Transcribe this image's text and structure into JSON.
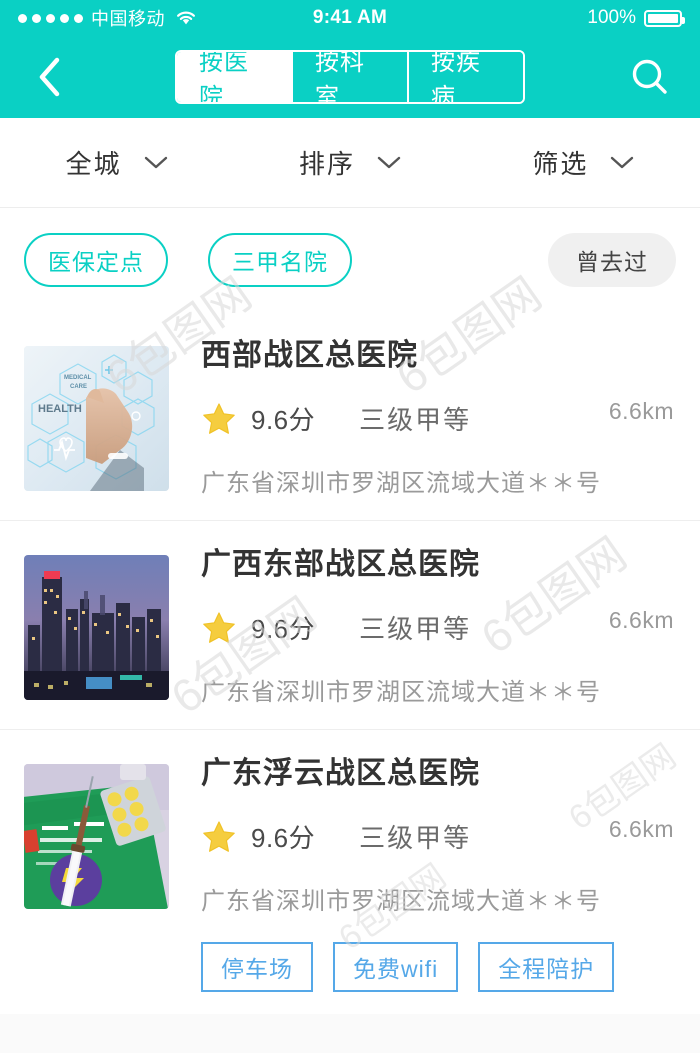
{
  "status_bar": {
    "signal_dots": 5,
    "carrier": "中国移动",
    "wifi_icon": "wifi-icon",
    "time": "9:41 AM",
    "battery_percent": "100%",
    "battery_icon": "battery-full-icon"
  },
  "nav": {
    "back_icon": "chevron-left-icon",
    "search_icon": "search-icon",
    "tabs": [
      {
        "label": "按医院",
        "active": true
      },
      {
        "label": "按科室",
        "active": false
      },
      {
        "label": "按疾病",
        "active": false
      }
    ]
  },
  "filters": [
    {
      "label": "全城",
      "icon": "chevron-down-icon"
    },
    {
      "label": "排序",
      "icon": "chevron-down-icon"
    },
    {
      "label": "筛选",
      "icon": "chevron-down-icon"
    }
  ],
  "chips": [
    {
      "label": "医保定点",
      "style": "outline"
    },
    {
      "label": "三甲名院",
      "style": "outline"
    },
    {
      "label": "曾去过",
      "style": "solid"
    }
  ],
  "hospitals": [
    {
      "name": "西部战区总医院",
      "star_icon": "star-icon",
      "score": "9.6分",
      "level": "三级甲等",
      "distance": "6.6km",
      "address": "广东省深圳市罗湖区流域大道＊＊号",
      "thumb": "medical-tech-photo",
      "thumb_text_1": "MEDICAL",
      "thumb_text_2": "CARE",
      "thumb_text_3": "HEALTH",
      "tags": []
    },
    {
      "name": "广西东部战区总医院",
      "star_icon": "star-icon",
      "score": "9.6分",
      "level": "三级甲等",
      "distance": "6.6km",
      "address": "广东省深圳市罗湖区流域大道＊＊号",
      "thumb": "city-skyline-photo",
      "tags": []
    },
    {
      "name": "广东浮云战区总医院",
      "star_icon": "star-icon",
      "score": "9.6分",
      "level": "三级甲等",
      "distance": "6.6km",
      "address": "广东省深圳市罗湖区流域大道＊＊号",
      "thumb": "vaccine-card-photo",
      "tags": [
        "停车场",
        "免费wifi",
        "全程陪护"
      ]
    }
  ],
  "watermarks": [
    "6包图网",
    "6包图网",
    "6包图网",
    "6包图网",
    "6包图网",
    "6包图网"
  ],
  "colors": {
    "brand_teal": "#0ad0c4",
    "tag_blue": "#55a8e8",
    "star_yellow": "#f5cd3f",
    "chip_gray_bg": "#f0f0f0",
    "text_primary": "#333333",
    "text_muted": "#9a9a9a"
  }
}
